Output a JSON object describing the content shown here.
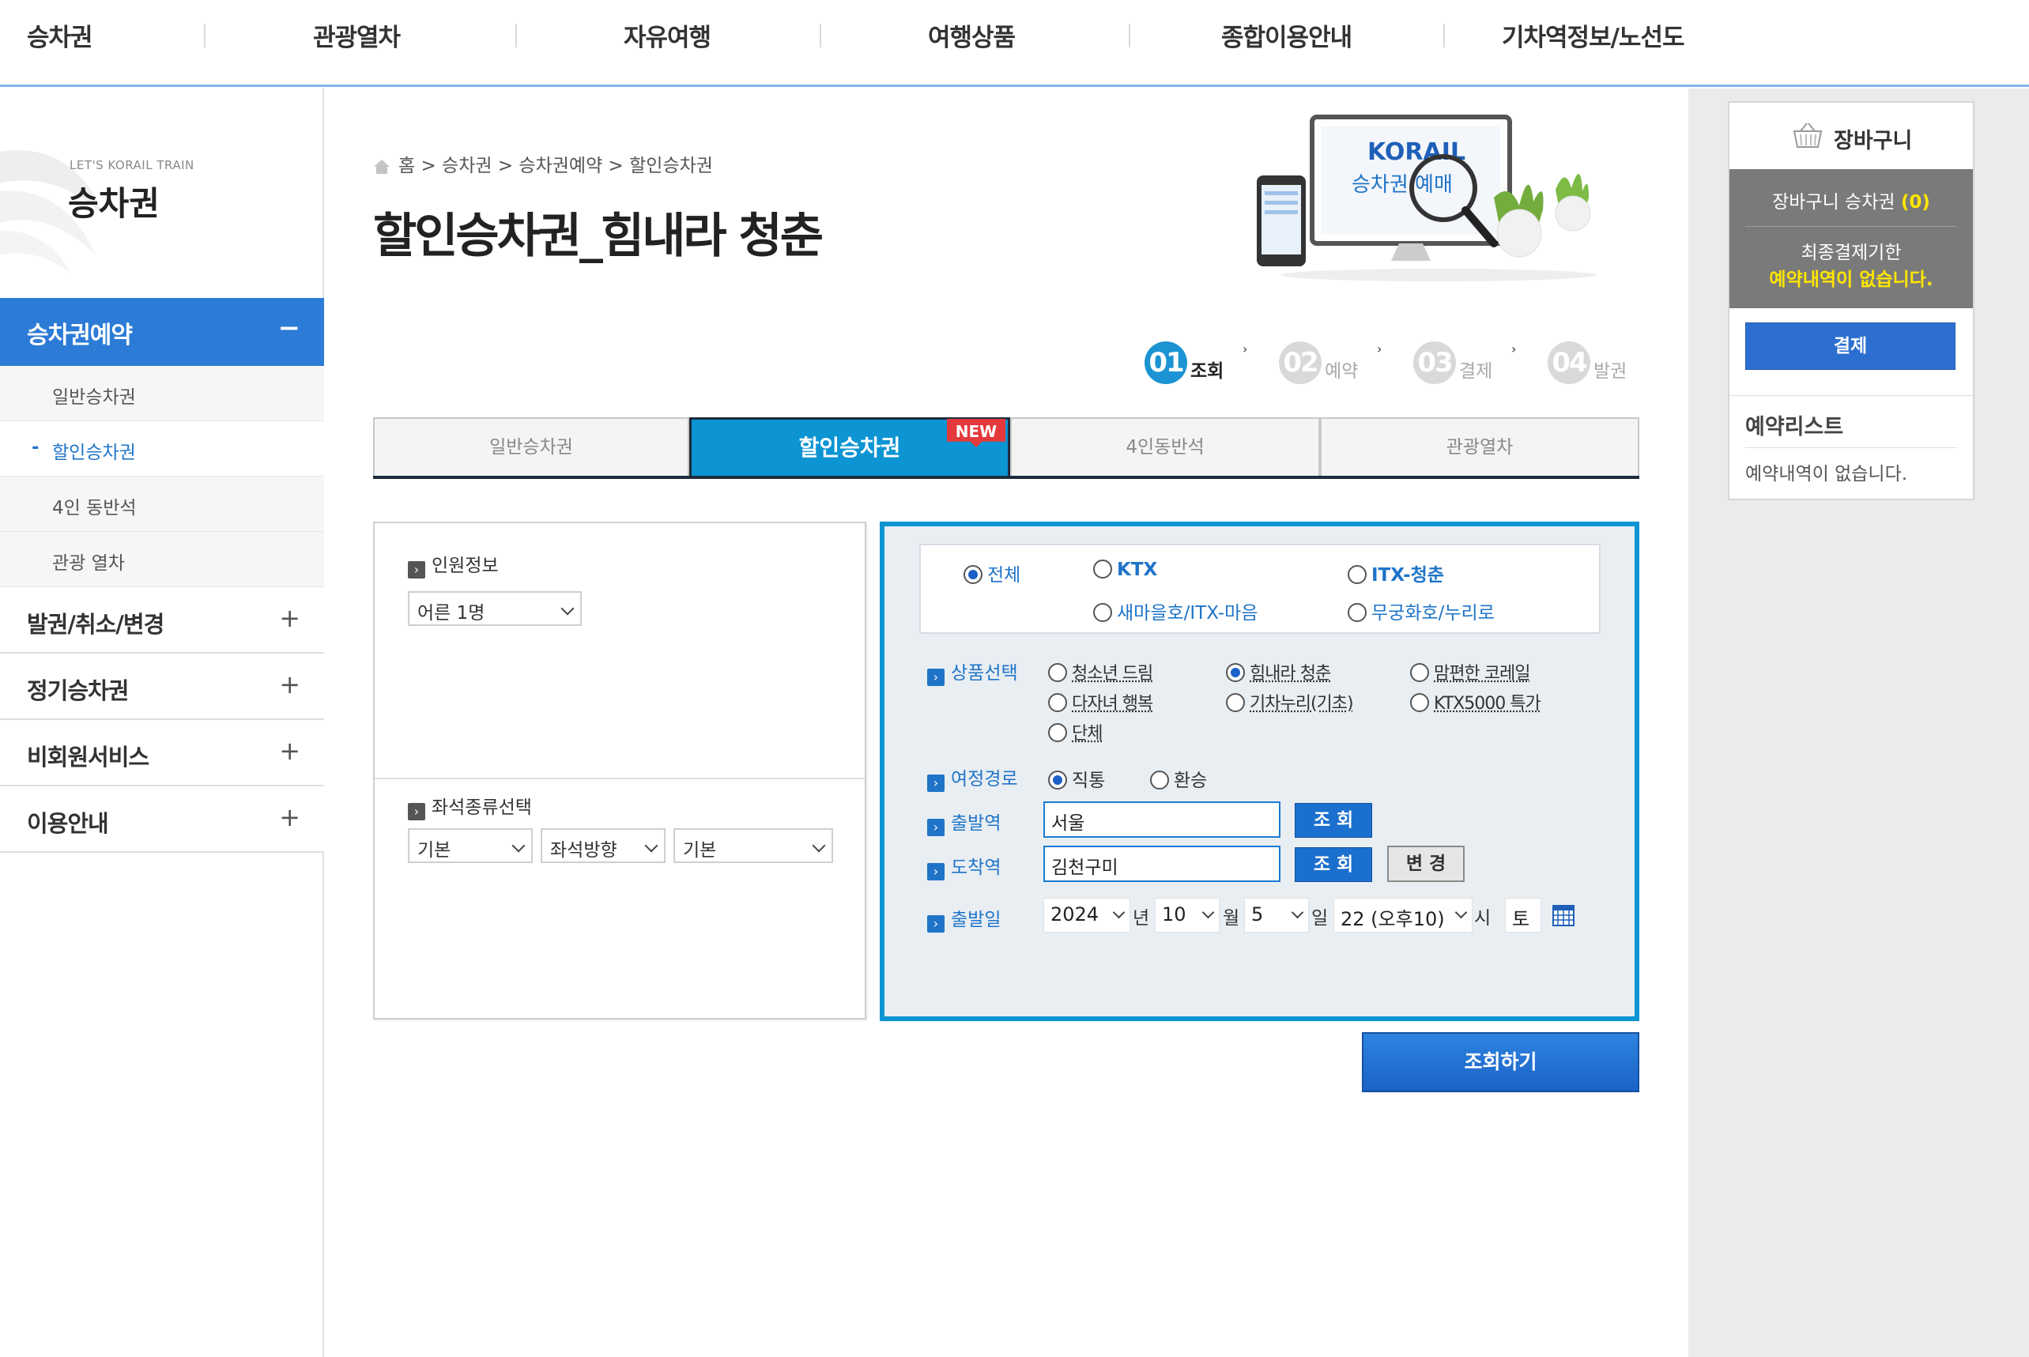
{
  "topnav": {
    "items": [
      "승차권",
      "관광열차",
      "자유여행",
      "여행상품",
      "종합이용안내",
      "기차역정보/노선도"
    ]
  },
  "sidebar": {
    "brand_small": "LET'S KORAIL TRAIN",
    "brand_big": "승차권",
    "active_menu": "승차권예약",
    "active_sign": "−",
    "subitems": [
      "일반승차권",
      "할인승차권",
      "4인 동반석",
      "관광 열차"
    ],
    "current_dash": "-",
    "menus": [
      "발권/취소/변경",
      "정기승차권",
      "비회원서비스",
      "이용안내"
    ],
    "plus": "+"
  },
  "breadcrumb": "홈 > 승차권 > 승차권예약 > 할인승차권",
  "page_title": "할인승차권_힘내라 청춘",
  "hero": {
    "brand": "KORAIL",
    "caption": "승차권 예매"
  },
  "steps": [
    {
      "num": "01",
      "label": "조회"
    },
    {
      "num": "02",
      "label": "예약"
    },
    {
      "num": "03",
      "label": "결제"
    },
    {
      "num": "04",
      "label": "발권"
    }
  ],
  "step_chevron": "›",
  "tabs": [
    "일반승차권",
    "할인승차권",
    "4인동반석",
    "관광열차"
  ],
  "new_badge": "NEW",
  "left_form": {
    "passenger_label": "인원정보",
    "passenger_value": "어른 1명",
    "seat_label": "좌석종류선택",
    "seat_values": [
      "기본",
      "좌석방향",
      "기본"
    ]
  },
  "right_form": {
    "train_types": [
      "전체",
      "KTX",
      "ITX-청춘",
      "새마을호/ITX-마음",
      "무궁화호/누리로"
    ],
    "product_label": "상품선택",
    "products": [
      "청소년 드림",
      "힘내라 청춘",
      "맘편한 코레일",
      "다자녀 행복",
      "기차누리(기초)",
      "KTX5000 특가",
      "단체"
    ],
    "route_label": "여정경로",
    "routes": [
      "직통",
      "환승"
    ],
    "depart_label": "출발역",
    "depart_value": "서울",
    "arrive_label": "도착역",
    "arrive_value": "김천구미",
    "lookup_btn": "조 회",
    "change_btn": "변 경",
    "date_label": "출발일",
    "year": "2024",
    "year_unit": "년",
    "month": "10",
    "month_unit": "월",
    "day": "5",
    "day_unit": "일",
    "hour": "22 (오후10)",
    "hour_unit": "시",
    "weekday": "토"
  },
  "search_btn": "조회하기",
  "cart": {
    "title": "장바구니",
    "tickets_label": "장바구니 승차권",
    "tickets_count": "(0)",
    "deadline_label": "최종결제기한",
    "deadline_value": "예약내역이 없습니다.",
    "pay_btn": "결제",
    "rlist_title": "예약리스트",
    "rlist_empty": "예약내역이 없습니다."
  },
  "colors": {
    "accent": "#0c94d3",
    "menu_active": "#2c7bd6",
    "badge": "#e4393c",
    "highlight": "#ffe600"
  }
}
